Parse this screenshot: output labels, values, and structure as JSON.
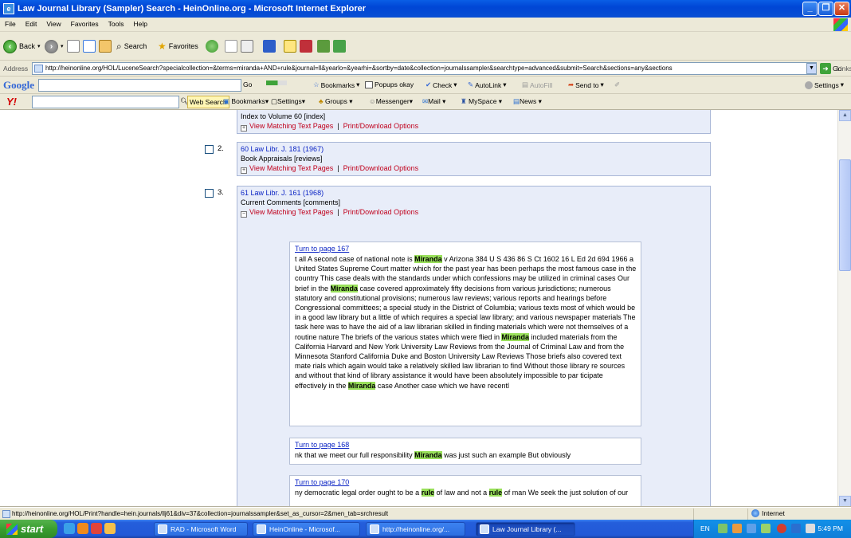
{
  "window": {
    "title": "Law Journal Library (Sampler) Search - HeinOnline.org - Microsoft Internet Explorer",
    "controls": [
      "_",
      "❐",
      "✕"
    ]
  },
  "menubar": {
    "items": [
      "File",
      "Edit",
      "View",
      "Favorites",
      "Tools",
      "Help"
    ]
  },
  "toolbar": {
    "back": "Back",
    "search": "Search",
    "favorites": "Favorites"
  },
  "addressbar": {
    "label": "Address",
    "url": "http://heinonline.org/HOL/LuceneSearch?specialcollection=&terms=miranda+AND+rule&journal=ll&yearlo=&yearhi=&sortby=date&collection=journalssampler&searchtype=advanced&submit=Search&sections=any&sections",
    "go": "Go",
    "links": "Links"
  },
  "googlebar": {
    "logo": "Google",
    "go": "Go",
    "bookmarks": "Bookmarks",
    "popups": "Popups okay",
    "check": "Check",
    "autolink": "AutoLink",
    "autofill": "AutoFill",
    "sendto": "Send to",
    "settings": "Settings"
  },
  "yahoobar": {
    "logo": "Y!",
    "websearch": "Web Search",
    "bookmarks": "Bookmarks",
    "settings": "Settings",
    "groups": "Groups",
    "messenger": "Messenger",
    "mail": "Mail",
    "myspace": "MySpace",
    "news": "News"
  },
  "results": [
    {
      "number": "",
      "citation": "",
      "description": "Index to Volume 60 [index]",
      "view_link": "View Matching Text Pages",
      "print_link": "Print/Download Options"
    },
    {
      "number": "2.",
      "citation": "60 Law Libr. J. 181 (1967)",
      "description": "Book Appraisals [reviews]",
      "view_link": "View Matching Text Pages",
      "print_link": "Print/Download Options"
    },
    {
      "number": "3.",
      "citation": "61 Law Libr. J. 161 (1968)",
      "description": "Current Comments [comments]",
      "view_link": "View Matching Text Pages",
      "print_link": "Print/Download Options"
    }
  ],
  "separator": "|",
  "snippets": [
    {
      "turn_label": "Turn to page 167",
      "parts": [
        {
          "t": "t all A second case of national note is ",
          "h": false
        },
        {
          "t": "Miranda",
          "h": true
        },
        {
          "t": " v Arizona 384 U S 436 86 S Ct 1602 16 L Ed 2d 694 1966 a United States Supreme Court matter which for the past year has been perhaps the most famous case in the country This case deals with the standards under which confessions may be utilized in criminal cases Our brief in the ",
          "h": false
        },
        {
          "t": "Miranda",
          "h": true
        },
        {
          "t": " case covered approximately fifty decisions from various jurisdictions; numerous statutory and constitutional provisions; numerous law reviews; various reports and hearings before Congressional committees; a special study in the District of Columbia; various texts most of which would be in a good law library but a little of which requires a special law library; and various newspaper materials The task here was to have the aid of a law librarian skilled in finding materials which were not themselves of a routine nature The briefs of the various states which were flied in ",
          "h": false
        },
        {
          "t": "Miranda",
          "h": true
        },
        {
          "t": " included materials from the California Harvard and New York University Law Reviews from the Journal of Criminal Law and from the Minnesota Stanford California Duke and Boston University Law Reviews Those briefs also covered text mate rials which again would take a relatively skilled law librarian to find Without those library re sources and without that kind of library assistance it would have been absolutely impossible to par ticipate effectively in the ",
          "h": false
        },
        {
          "t": "Miranda",
          "h": true
        },
        {
          "t": " case Another case which we have recentl",
          "h": false
        }
      ]
    },
    {
      "turn_label": "Turn to page 168",
      "parts": [
        {
          "t": "nk that we meet our full responsibility ",
          "h": false
        },
        {
          "t": "Miranda",
          "h": true
        },
        {
          "t": " was just such an example But obviously",
          "h": false
        }
      ]
    },
    {
      "turn_label": "Turn to page 170",
      "parts": [
        {
          "t": "ny democratic legal order ought to be a ",
          "h": false
        },
        {
          "t": "rule",
          "h": true
        },
        {
          "t": " of law and not a ",
          "h": false
        },
        {
          "t": "rule",
          "h": true
        },
        {
          "t": " of man We seek the just solution of our",
          "h": false
        }
      ]
    }
  ],
  "statusbar": {
    "text": "http://heinonline.org/HOL/Print?handle=hein.journals/llj61&div=37&collection=journalssampler&set_as_cursor=2&men_tab=srchresult",
    "zone": "Internet"
  },
  "taskbar": {
    "start": "start",
    "tasks": [
      "RAD - Microsoft Word",
      "HeinOnline - Microsof...",
      "http://heinonline.org/...",
      "Law Journal Library (..."
    ],
    "lang": "EN",
    "clock": "5:49 PM"
  }
}
